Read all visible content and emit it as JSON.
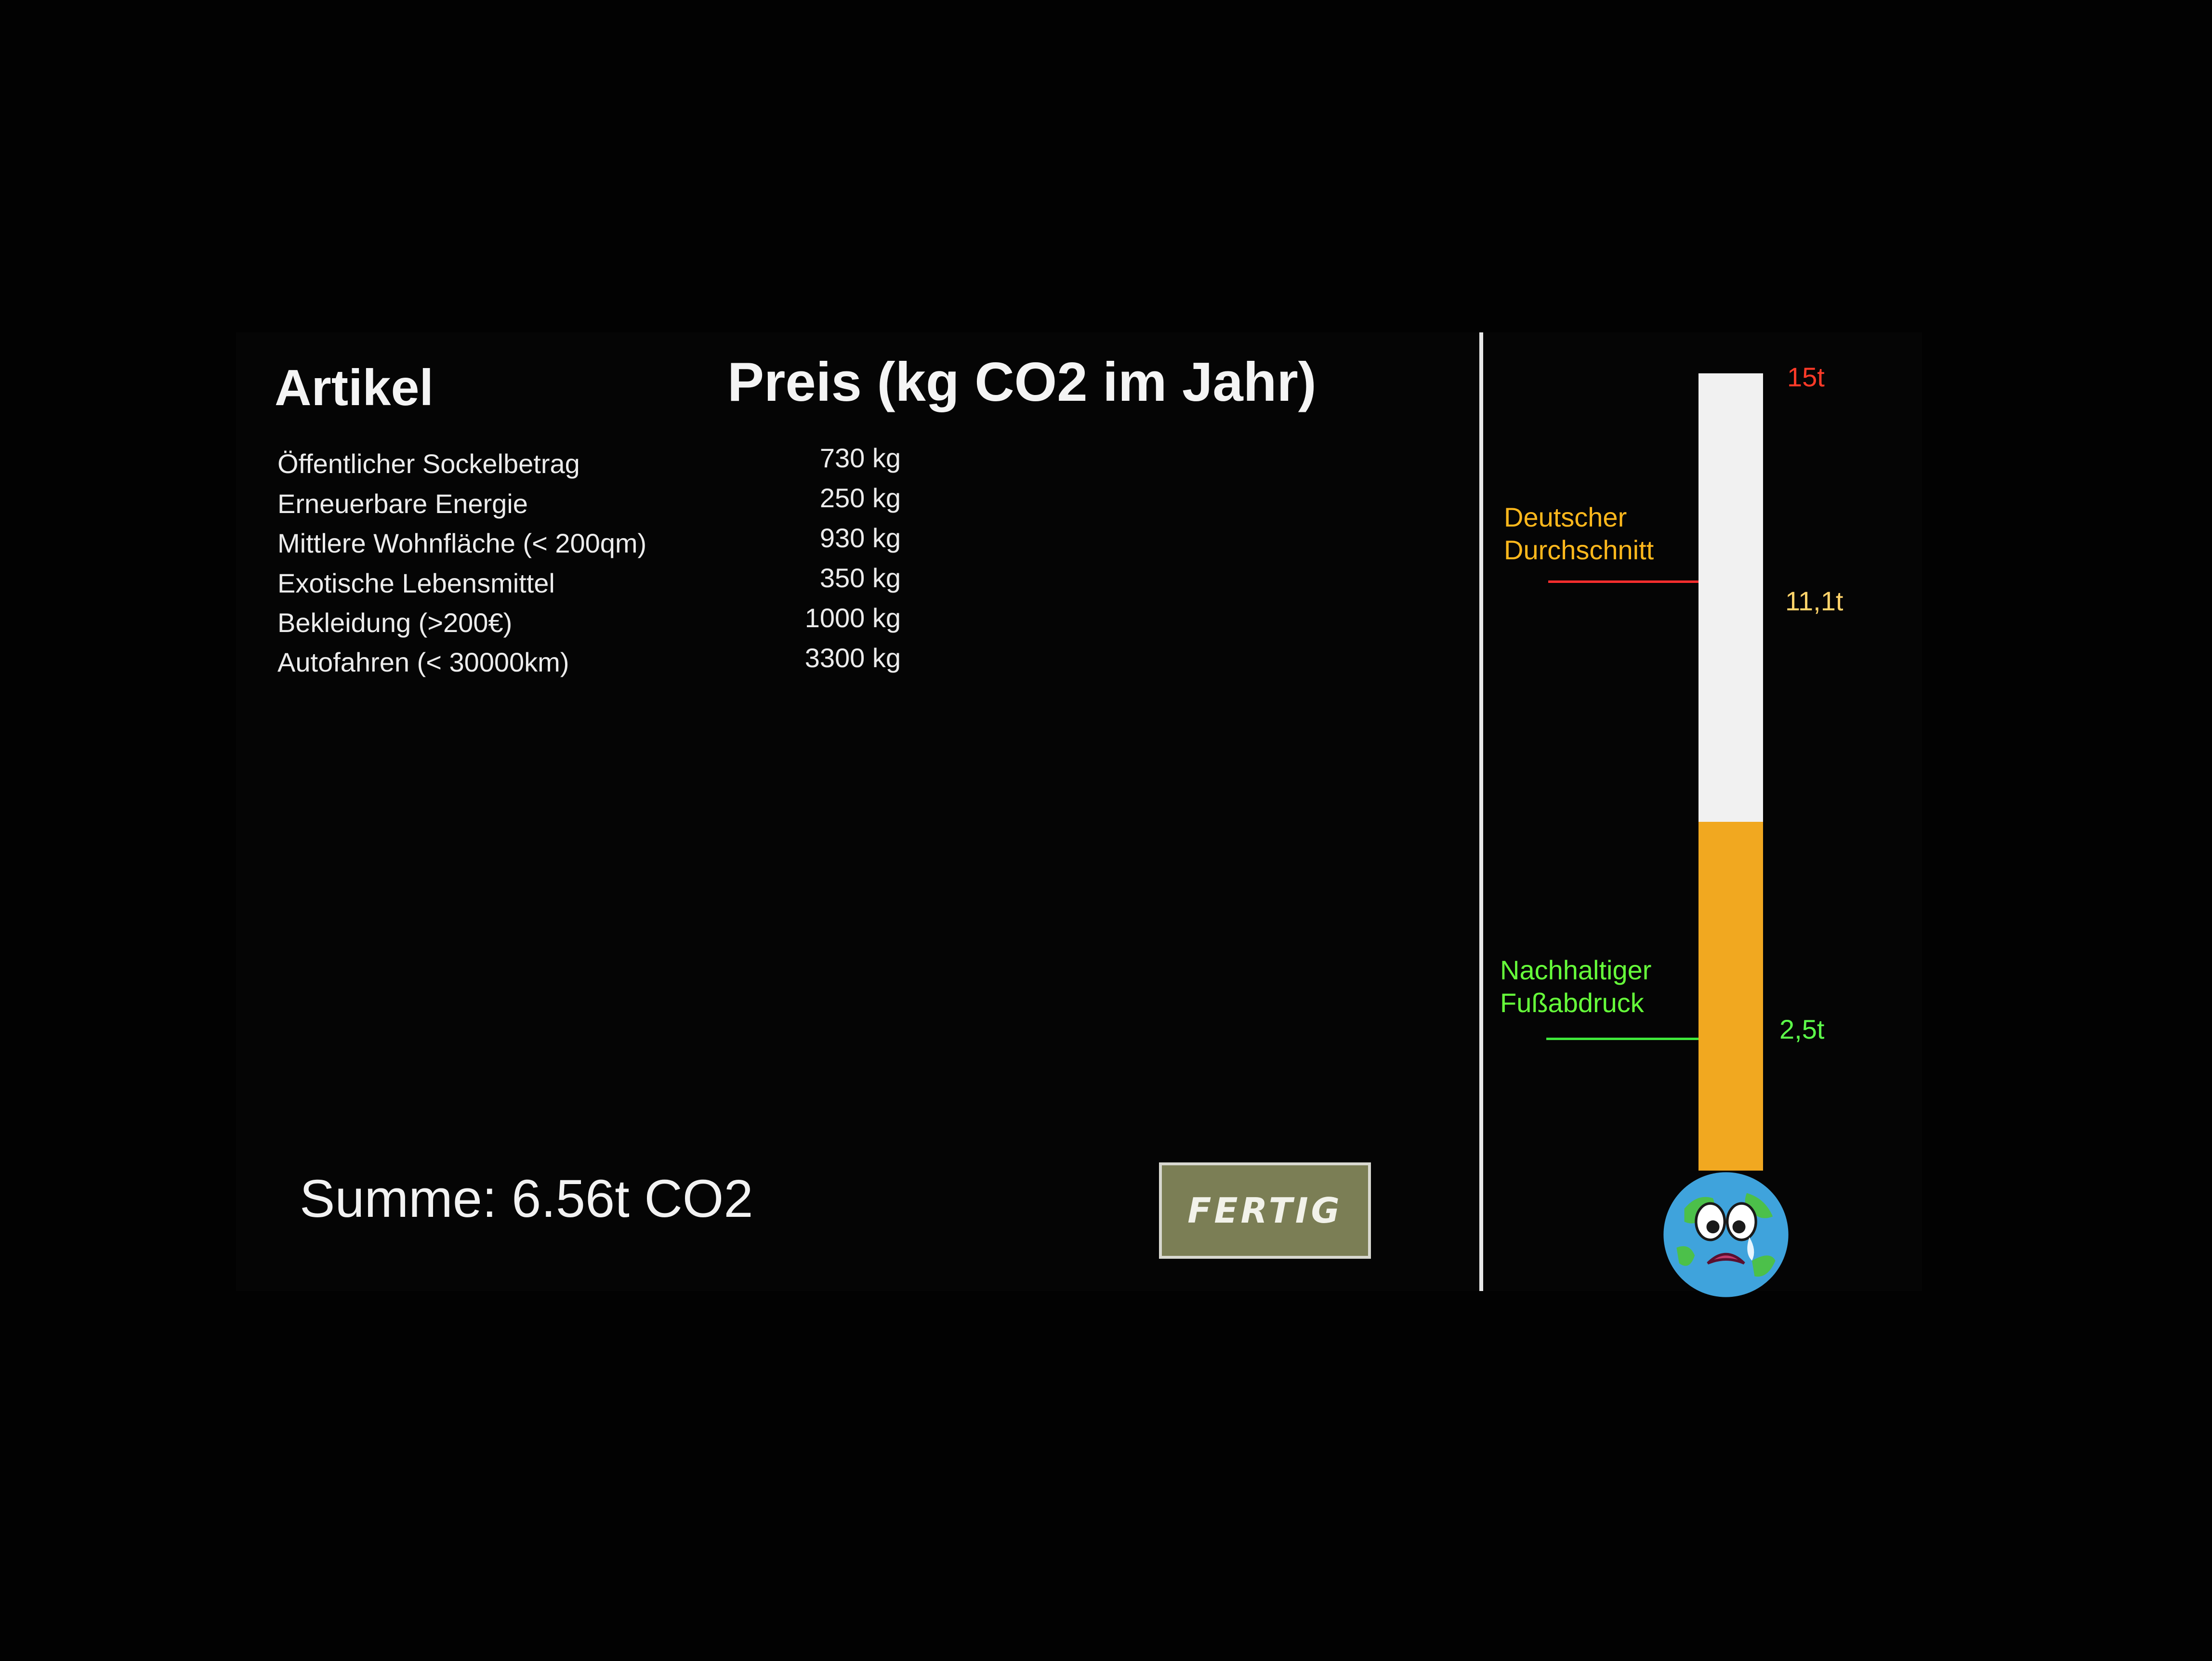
{
  "header": {
    "item_label": "Artikel",
    "price_label": "Preis (kg CO2 im Jahr)"
  },
  "items": [
    {
      "name": "Öffentlicher Sockelbetrag",
      "value": "730 kg"
    },
    {
      "name": "Erneuerbare Energie",
      "value": "250 kg"
    },
    {
      "name": "Mittlere Wohnfläche (< 200qm)",
      "value": "930 kg"
    },
    {
      "name": "Exotische Lebensmittel",
      "value": "350 kg"
    },
    {
      "name": "Bekleidung (>200€)",
      "value": "1000 kg"
    },
    {
      "name": "Autofahren (< 30000km)",
      "value": "3300 kg"
    }
  ],
  "summary": {
    "label": "Summe: 6.56t CO2"
  },
  "button": {
    "label": "FERTIG"
  },
  "thermometer": {
    "max_label": "15t",
    "average_label": "11,1t",
    "average_text_line1": "Deutscher",
    "average_text_line2": "Durchschnitt",
    "sustainable_label": "2,5t",
    "sustainable_text_line1": "Nachhaltiger",
    "sustainable_text_line2": "Fußabdruck",
    "max_value_t": 15,
    "average_value_t": 11.1,
    "sustainable_value_t": 2.5,
    "current_value_t": 6.56
  },
  "colors": {
    "fill": "#f1a820",
    "track": "#f1f1f1",
    "max_label": "#ff3a28",
    "average_label": "#ffd36a",
    "average_line": "#ff2e2e",
    "sustainable": "#5dff4a",
    "button_bg": "#7b7e55"
  },
  "icons": {
    "mascot": "crying-earth-icon"
  }
}
